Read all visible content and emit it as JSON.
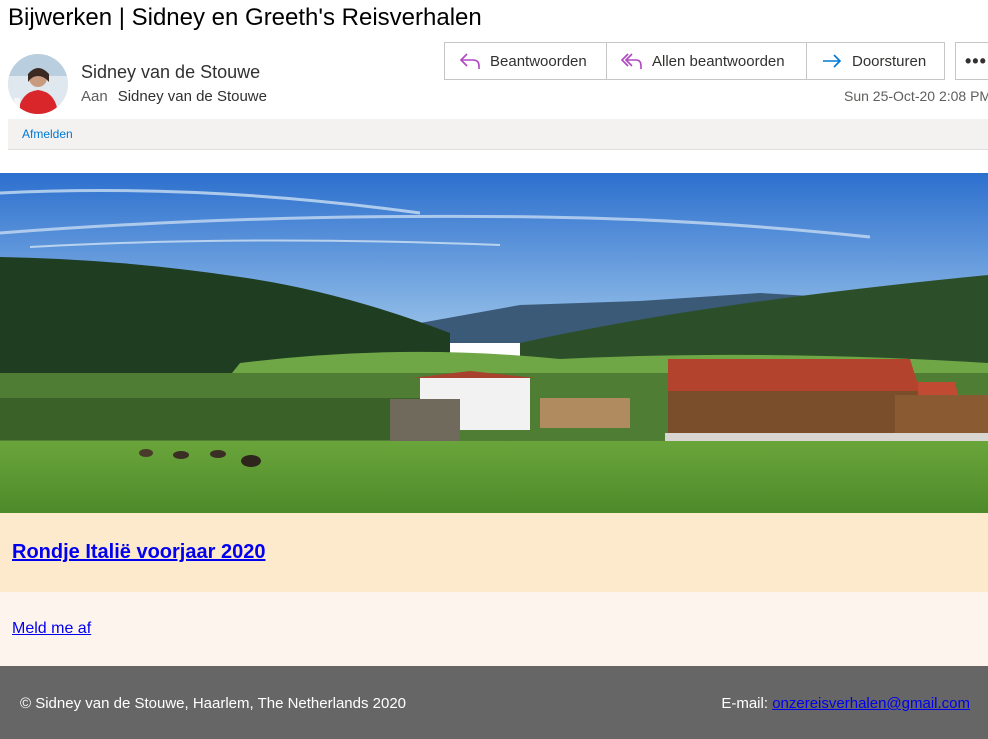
{
  "email": {
    "subject": "Bijwerken | Sidney en Greeth's Reisverhalen",
    "sender_name": "Sidney van de Stouwe",
    "to_label": "Aan",
    "recipient": "Sidney van de Stouwe",
    "date": "Sun 25-Oct-20 2:08 PM"
  },
  "toolbar": {
    "reply_label": "Beantwoorden",
    "reply_all_label": "Allen beantwoorden",
    "forward_label": "Doorsturen",
    "more_label": "•••"
  },
  "unsubscribe_bar": {
    "label": "Afmelden"
  },
  "newsletter": {
    "post_title": "Rondje Italië voorjaar 2020",
    "unsubscribe_link": "Meld me af",
    "footer_copyright": "© Sidney van de Stouwe, Haarlem, The Netherlands 2020",
    "footer_email_label": "E-mail:",
    "footer_email": "onzereisverhalen@gmail.com"
  },
  "colors": {
    "link": "#0000ee",
    "title_band": "#fde9cc",
    "unsub_band": "#fef4ee",
    "footer_bg": "#666666",
    "reply_icon": "#b146c2",
    "forward_icon": "#0078d4"
  },
  "icons": [
    "reply-icon",
    "reply-all-icon",
    "forward-icon",
    "more-icon",
    "avatar"
  ]
}
